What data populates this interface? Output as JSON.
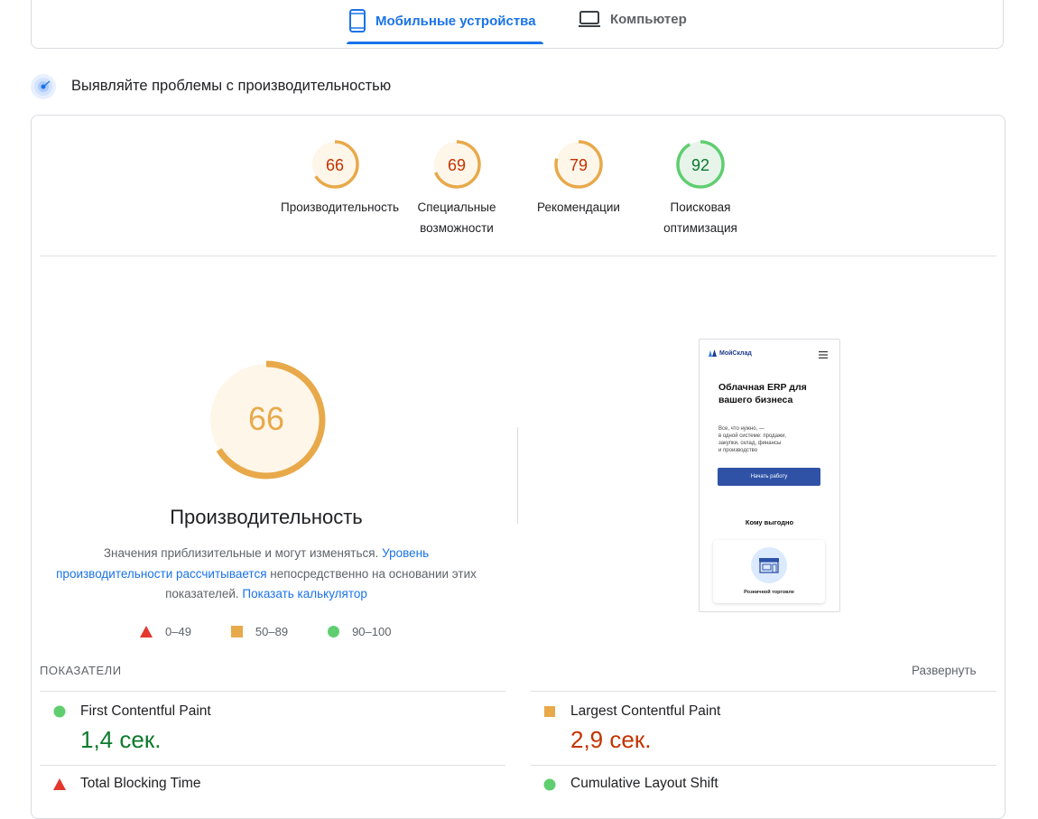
{
  "tabs": [
    {
      "label": "Мобильные устройства",
      "active": true,
      "icon": "phone-icon"
    },
    {
      "label": "Компьютер",
      "active": false,
      "icon": "laptop-icon"
    }
  ],
  "section": {
    "title": "Выявляйте проблемы с производительностью",
    "icon": "radar-icon"
  },
  "scores": [
    {
      "value": "66",
      "label_lines": [
        "Производительность"
      ],
      "level": "average"
    },
    {
      "value": "69",
      "label_lines": [
        "Специальные",
        "возможности"
      ],
      "level": "average"
    },
    {
      "value": "79",
      "label_lines": [
        "Рекомендации"
      ],
      "level": "average"
    },
    {
      "value": "92",
      "label_lines": [
        "Поисковая",
        "оптимизация"
      ],
      "level": "good"
    }
  ],
  "colors": {
    "average_stroke": "#e8a94a",
    "average_text": "#c33300",
    "average_fill": "#fff6ea",
    "good_stroke": "#5fce6f",
    "good_text": "#0b7a2c",
    "good_fill": "#e6f4ea",
    "fail": "#e3372e",
    "link": "#1a73e8"
  },
  "main_score": {
    "value": "66",
    "title": "Производительность"
  },
  "description": {
    "text1": "Значения приблизительные и могут изменяться.",
    "link1": "Уровень производительности рассчитывается",
    "text2": "непосредственно на основании этих показателей.",
    "link2": "Показать калькулятор"
  },
  "legend": [
    {
      "range": "0–49",
      "shape": "triangle"
    },
    {
      "range": "50–89",
      "shape": "square"
    },
    {
      "range": "90–100",
      "shape": "circle"
    }
  ],
  "metrics_header": {
    "label": "ПОКАЗАТЕЛИ",
    "expand": "Развернуть"
  },
  "metrics": [
    {
      "name": "First Contentful Paint",
      "value": "1,4 сек.",
      "status": "good"
    },
    {
      "name": "Largest Contentful Paint",
      "value": "2,9 сек.",
      "status": "average"
    },
    {
      "name": "Total Blocking Time",
      "value": "",
      "status": "fail"
    },
    {
      "name": "Cumulative Layout Shift",
      "value": "",
      "status": "good"
    }
  ],
  "preview": {
    "logo": "МойСклад",
    "heading": "Облачная ERP для вашего бизнеса",
    "text_lines": [
      "Все, что нужно, —",
      "в одной системе: продажи,",
      "закупки, склад, финансы",
      "и производство"
    ],
    "button": "Начать работу",
    "subheading": "Кому выгодно",
    "card_label": "Розничной торговле"
  }
}
